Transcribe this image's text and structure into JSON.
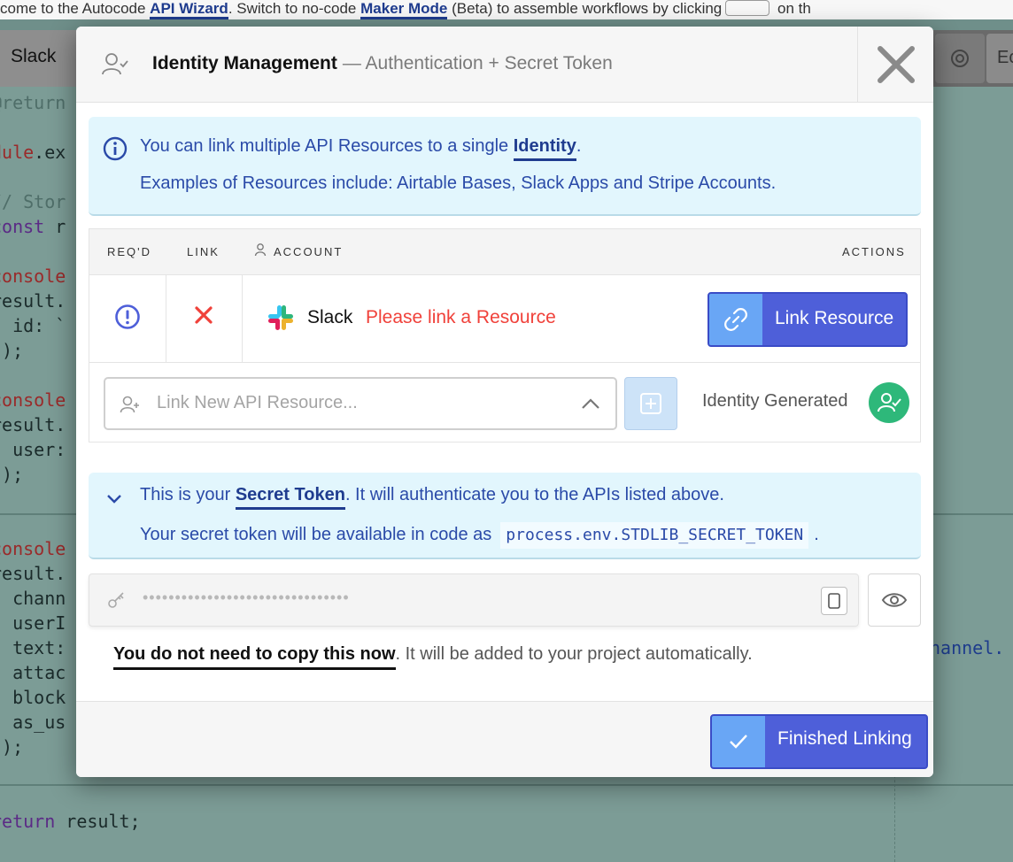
{
  "background": {
    "top_prefix": "come to the Autocode ",
    "top_link1": "API Wizard",
    "top_middle": ". Switch to no-code ",
    "top_link2": "Maker Mode",
    "top_after": " (Beta) to assemble workflows by clicking",
    "top_end": " on th",
    "tab_label": "Slack",
    "tab2_label": "Ec",
    "code": {
      "l1": "@return",
      "l2a": "dule",
      "l2b": ".ex",
      "l3": "// Stor",
      "l4a": "const",
      "l4b": " r",
      "l5": "console",
      "l6": "result.",
      "l7": "  id: `",
      "l8": "});",
      "l9": "console",
      "l10": "result.",
      "l11": "  user:",
      "l12": "});",
      "l13": "console",
      "l14": "result.",
      "l15": "  chann",
      "l16": "  userI",
      "l17": "  text:",
      "l18": "  attac",
      "l19": "  block",
      "l20": "  as_us",
      "l21": "});",
      "l22a": "return",
      "l22b": " result;",
      "right": "hannel."
    }
  },
  "modal": {
    "title": "Identity Management",
    "subtitle": "— Authentication + Secret Token",
    "info": {
      "line1_prefix": "You can link multiple API Resources to a single ",
      "line1_link": "Identity",
      "line1_suffix": ".",
      "line2": "Examples of Resources include: Airtable Bases, Slack Apps and Stripe Accounts."
    },
    "table": {
      "headers": {
        "reqd": "REQ'D",
        "link": "LINK",
        "account": "ACCOUNT",
        "actions": "ACTIONS"
      },
      "row": {
        "account_name": "Slack",
        "warning": "Please link a Resource",
        "action_label": "Link Resource"
      }
    },
    "new_resource": {
      "placeholder": "Link New API Resource...",
      "identity_status": "Identity Generated"
    },
    "secret": {
      "line1_prefix": "This is your ",
      "line1_link": "Secret Token",
      "line1_suffix": ". It will authenticate you to the APIs listed above.",
      "line2_prefix": "Your secret token will be available in code as",
      "env_var": "process.env.STDLIB_SECRET_TOKEN",
      "line2_suffix": ".",
      "masked_value": "••••••••••••••••••••••••••••••••"
    },
    "note": {
      "bold": "You do not need to copy this now",
      "rest": ". It will be added to your project automatically."
    },
    "footer": {
      "finish_label": "Finished Linking"
    }
  },
  "colors": {
    "accent": "#4e5fd9",
    "accent_light": "#69a6f5",
    "info_bg": "#e2f6fd",
    "info_text": "#2a4aa8",
    "warning": "#f0413a",
    "success": "#2eb87a"
  }
}
